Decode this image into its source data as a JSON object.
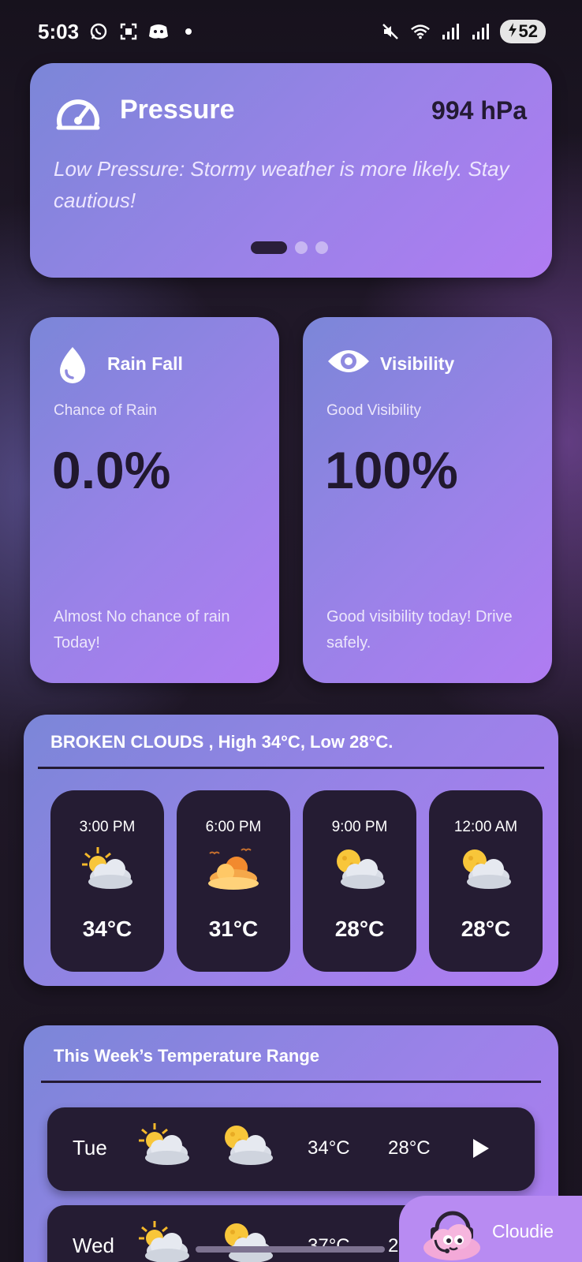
{
  "status_bar": {
    "time": "5:03",
    "battery": "52",
    "left_icons": [
      "whatsapp-icon",
      "screenshot-icon",
      "discord-icon",
      "dot-icon"
    ],
    "right_icons": [
      "mute-icon",
      "wifi-icon",
      "signal-icon",
      "signal-icon",
      "battery-charging-icon"
    ]
  },
  "pressure": {
    "title": "Pressure",
    "value": "994 hPa",
    "description": "Low Pressure: Stormy weather is more likely. Stay cautious!",
    "icon": "gauge-icon",
    "carousel_pages": 3,
    "carousel_active": 1
  },
  "rain": {
    "title": "Rain Fall",
    "subtitle": "Chance of Rain",
    "value": "0.0%",
    "note": "Almost No chance of rain Today!",
    "icon": "water-drop-icon"
  },
  "visibility": {
    "title": "Visibility",
    "subtitle": "Good Visibility",
    "value": "100%",
    "note": "Good visibility today! Drive safely.",
    "icon": "eye-icon"
  },
  "forecast": {
    "summary": "BROKEN CLOUDS , High 34°C, Low 28°C.",
    "hours": [
      {
        "time": "3:00 PM",
        "temp": "34°C",
        "icon": "sun-cloud-icon"
      },
      {
        "time": "6:00 PM",
        "temp": "31°C",
        "icon": "sunset-cloud-icon"
      },
      {
        "time": "9:00 PM",
        "temp": "28°C",
        "icon": "moon-cloud-icon"
      },
      {
        "time": "12:00 AM",
        "temp": "28°C",
        "icon": "moon-cloud-icon"
      }
    ]
  },
  "week": {
    "title": "This Week’s Temperature Range",
    "days": [
      {
        "day": "Tue",
        "high": "34°C",
        "low": "28°C",
        "day_icon": "sun-cloud-icon",
        "night_icon": "moon-cloud-icon"
      },
      {
        "day": "Wed",
        "high": "37°C",
        "low": "2",
        "day_icon": "sun-cloud-icon",
        "night_icon": "moon-cloud-icon"
      }
    ]
  },
  "assistant": {
    "label": "Cloudie",
    "icon": "cloud-mascot-icon"
  },
  "colors": {
    "card_gradient_start": "#7b86d8",
    "card_gradient_end": "#b07cf2",
    "dark_tile": "#251c33",
    "background": "#1a1422"
  }
}
